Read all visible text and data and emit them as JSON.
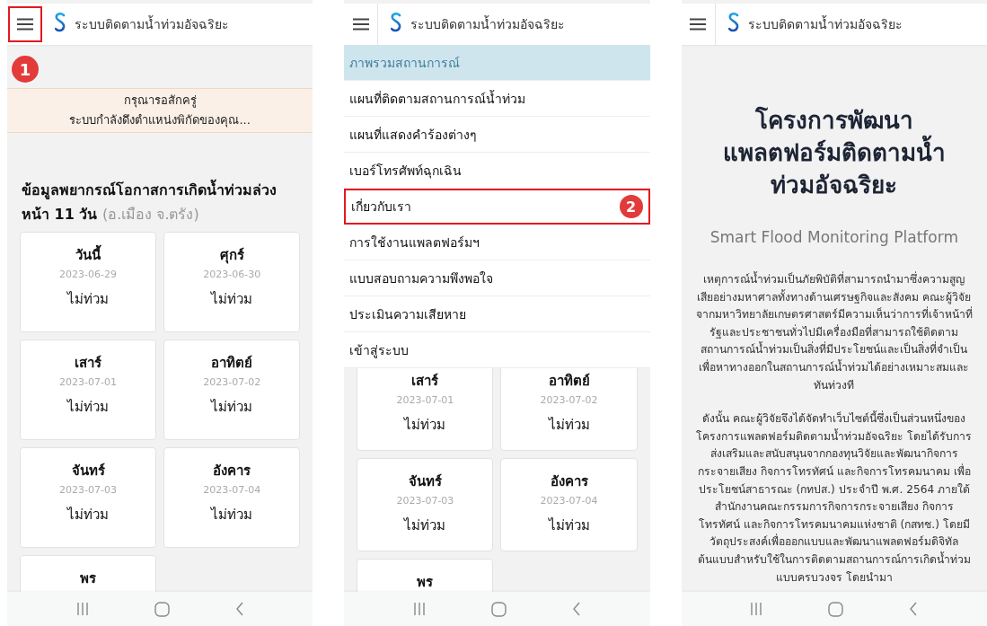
{
  "screens": [
    {
      "kind": "forecast",
      "step": "1",
      "header": {
        "title": "ระบบติดตามน้ำท่วมอัจฉริยะ",
        "menu_highlighted": true
      },
      "notice": [
        "กรุณารอสักครู่",
        "ระบบกำลังดึงตำแหน่งพิกัดของคุณ..."
      ],
      "heading": "ข้อมูลพยากรณ์โอกาสการเกิดน้ำท่วมล่วงหน้า 11 วัน",
      "location": "(อ.เมือง จ.ตรัง)",
      "days": [
        {
          "day": "วันนี้",
          "date": "2023-06-29",
          "status": "ไม่ท่วม"
        },
        {
          "day": "ศุกร์",
          "date": "2023-06-30",
          "status": "ไม่ท่วม"
        },
        {
          "day": "เสาร์",
          "date": "2023-07-01",
          "status": "ไม่ท่วม"
        },
        {
          "day": "อาทิตย์",
          "date": "2023-07-02",
          "status": "ไม่ท่วม"
        },
        {
          "day": "จันทร์",
          "date": "2023-07-03",
          "status": "ไม่ท่วม"
        },
        {
          "day": "อังคาร",
          "date": "2023-07-04",
          "status": "ไม่ท่วม"
        },
        {
          "day": "พร"
        }
      ]
    },
    {
      "kind": "menu",
      "step": "2",
      "header": {
        "title": "ระบบติดตามน้ำท่วมอัจฉริยะ",
        "menu_highlighted": false
      },
      "menu": [
        {
          "label": "ภาพรวมสถานการณ์",
          "selected": true,
          "highlighted": false
        },
        {
          "label": "แผนที่ติดตามสถานการณ์น้ำท่วม",
          "selected": false,
          "highlighted": false
        },
        {
          "label": "แผนที่แสดงคำร้องต่างๆ",
          "selected": false,
          "highlighted": false
        },
        {
          "label": "เบอร์โทรศัพท์ฉุกเฉิน",
          "selected": false,
          "highlighted": false
        },
        {
          "label": "เกี่ยวกับเรา",
          "selected": false,
          "highlighted": true
        },
        {
          "label": "การใช้งานแพลตฟอร์มฯ",
          "selected": false,
          "highlighted": false
        },
        {
          "label": "แบบสอบถามความพึงพอใจ",
          "selected": false,
          "highlighted": false
        },
        {
          "label": "ประเมินความเสียหาย",
          "selected": false,
          "highlighted": false
        },
        {
          "label": "เข้าสู่ระบบ",
          "selected": false,
          "highlighted": false
        }
      ],
      "days": [
        {
          "day": "เสาร์",
          "date": "2023-07-01",
          "status": "ไม่ท่วม"
        },
        {
          "day": "อาทิตย์",
          "date": "2023-07-02",
          "status": "ไม่ท่วม"
        },
        {
          "day": "จันทร์",
          "date": "2023-07-03",
          "status": "ไม่ท่วม"
        },
        {
          "day": "อังคาร",
          "date": "2023-07-04",
          "status": "ไม่ท่วม"
        },
        {
          "day": "พร"
        }
      ]
    },
    {
      "kind": "about",
      "header": {
        "title": "ระบบติดตามน้ำท่วมอัจฉริยะ",
        "menu_highlighted": false
      },
      "title": "โครงการพัฒนาแพลตฟอร์มติดตามน้ำท่วมอัจฉริยะ",
      "subtitle": "Smart Flood Monitoring Platform",
      "paragraphs": [
        "เหตุการณ์น้ำท่วมเป็นภัยพิบัติที่สามารถนำมาซึ่งความสูญเสียอย่างมหาศาลทั้งทางด้านเศรษฐกิจและสังคม คณะผู้วิจัยจากมหาวิทยาลัยเกษตรศาสตร์มีความเห็นว่าการที่เจ้าหน้าที่รัฐและประชาชนทั่วไปมีเครื่องมือที่สามารถใช้ติดตามสถานการณ์น้ำท่วมเป็นสิ่งที่มีประโยชน์และเป็นสิ่งที่จำเป็นเพื่อหาทางออกในสถานการณ์น้ำท่วมได้อย่างเหมาะสมและทันท่วงที",
        "ดังนั้น คณะผู้วิจัยจึงได้จัดทำเว็บไซต์นี้ซึ่งเป็นส่วนหนึ่งของโครงการแพลตฟอร์มติดตามน้ำท่วมอัจฉริยะ โดยได้รับการส่งเสริมและสนับสนุนจากกองทุนวิจัยและพัฒนากิจการกระจายเสียง กิจการโทรทัศน์ และกิจการโทรคมนาคม เพื่อประโยชน์สาธารณะ (กทปส.) ประจำปี พ.ศ. 2564 ภายใต้สำนักงานคณะกรรมการกิจการกระจายเสียง กิจการโทรทัศน์ และกิจการโทรคมนาคมแห่งชาติ (กสทช.) โดยมีวัตถุประสงค์เพื่อออกแบบและพัฒนาแพลตฟอร์มดิจิทัลต้นแบบสำหรับใช้ในการติดตามสถานการณ์การเกิดน้ำท่วมแบบครบวงจร โดยนำมา"
      ]
    }
  ]
}
